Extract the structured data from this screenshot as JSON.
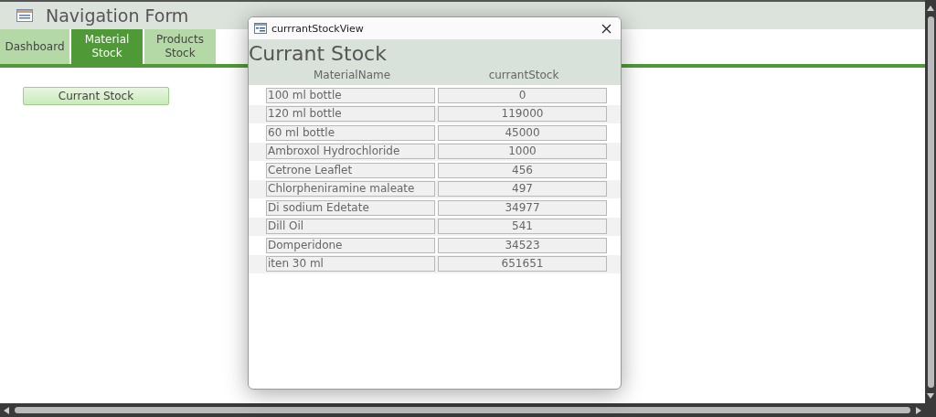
{
  "form": {
    "title": "Navigation Form"
  },
  "tabs": [
    {
      "label": "Dashboard",
      "selected": false
    },
    {
      "label": "Material Stock",
      "selected": true
    },
    {
      "label": "Products Stock",
      "selected": false
    }
  ],
  "content": {
    "button": "Currant Stock"
  },
  "popup": {
    "window_title": "currrantStockView",
    "heading": "Currant Stock",
    "columns": [
      "MaterialName",
      "currantStock"
    ],
    "rows": [
      {
        "name": "100 ml bottle",
        "stock": "0"
      },
      {
        "name": "120 ml bottle",
        "stock": "119000"
      },
      {
        "name": "60 ml bottle",
        "stock": "45000"
      },
      {
        "name": "Ambroxol Hydrochloride",
        "stock": "1000"
      },
      {
        "name": "Cetrone Leaflet",
        "stock": "456"
      },
      {
        "name": "Chlorpheniramine maleate",
        "stock": "497"
      },
      {
        "name": "Di sodium Edetate",
        "stock": "34977"
      },
      {
        "name": "Dill Oil",
        "stock": "541"
      },
      {
        "name": "Domperidone",
        "stock": "34523"
      },
      {
        "name": "iten 30 ml",
        "stock": "651651"
      }
    ]
  }
}
